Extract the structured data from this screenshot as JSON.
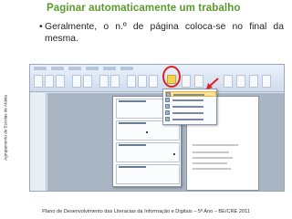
{
  "title": "Paginar automaticamente um trabalho",
  "bullet": "Geralmente, o n.º de página coloca-se no final da mesma.",
  "vertical_label": "Agrupamento de Escolas de Aldeia",
  "footer": "Plano de Desenvolvimento das Literacias da Informação e Digitais – 5º Ano – BE/CRE 2011",
  "colors": {
    "title": "#5a9a2e",
    "highlight": "#e02020"
  }
}
